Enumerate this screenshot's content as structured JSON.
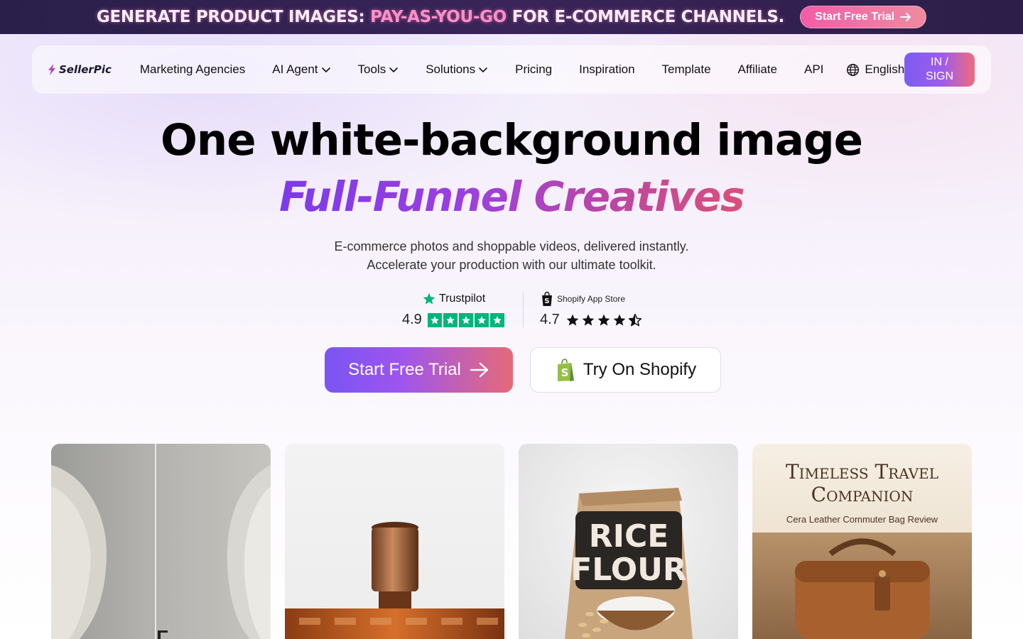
{
  "banner": {
    "text_prefix": "GENERATE PRODUCT IMAGES:",
    "text_highlight": "PAY-AS-YOU-GO",
    "text_suffix": "FOR E-COMMERCE CHANNELS.",
    "cta_label": "Start Free Trial"
  },
  "nav": {
    "logo_text": "SellerPic",
    "items": [
      {
        "label": "Marketing Agencies",
        "has_dropdown": false
      },
      {
        "label": "AI Agent",
        "has_dropdown": true
      },
      {
        "label": "Tools",
        "has_dropdown": true
      },
      {
        "label": "Solutions",
        "has_dropdown": true
      },
      {
        "label": "Pricing",
        "has_dropdown": false
      },
      {
        "label": "Inspiration",
        "has_dropdown": false
      },
      {
        "label": "Template",
        "has_dropdown": false
      },
      {
        "label": "Affiliate",
        "has_dropdown": false
      },
      {
        "label": "API",
        "has_dropdown": false
      }
    ],
    "language": "English",
    "signin_line1": "IN /",
    "signin_line2": "SIGN"
  },
  "hero": {
    "title": "One white-background image",
    "subtitle": "Full-Funnel Creatives",
    "desc_line1": "E-commerce photos and shoppable videos, delivered instantly.",
    "desc_line2": "Accelerate your production with our ultimate toolkit."
  },
  "ratings": {
    "trustpilot": {
      "name": "Trustpilot",
      "score": "4.9",
      "stars": 5
    },
    "shopify": {
      "name": "Shopify App Store",
      "score": "4.7",
      "stars": 4.5
    }
  },
  "cta": {
    "primary": "Start Free Trial",
    "secondary": "Try On Shopify"
  },
  "cards": {
    "card4_title_line1": "Timeless Travel",
    "card4_title_line2": "Companion",
    "card4_subtitle": "Cera Leather Commuter Bag Review",
    "card3_label_line1": "RICE",
    "card3_label_line2": "FLOUR"
  },
  "colors": {
    "banner_bg": "#2a1f4a",
    "banner_highlight": "#ff8fc8",
    "accent_purple": "#7a55f3",
    "accent_pink": "#e56a78",
    "trustpilot_green": "#00b67a",
    "shopify_green": "#95bf47"
  }
}
